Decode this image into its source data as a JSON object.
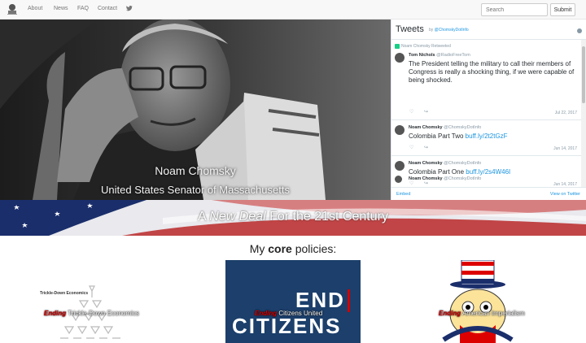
{
  "nav": {
    "links": [
      "About",
      "News",
      "FAQ",
      "Contact"
    ],
    "search_placeholder": "Search",
    "submit_label": "Submit"
  },
  "hero": {
    "name": "Noam Chomsky",
    "title": "United States Senator of Massachusetts"
  },
  "twitter": {
    "header": "Tweets",
    "by_prefix": "by",
    "by_handle": "@ChomskyDotInfo",
    "retweet_label": "Noam Chomsky Retweeted",
    "tweets": [
      {
        "author": "Tom Nichols",
        "handle": "@RadioFreeTom",
        "text": "The President telling the military to call their members of Congress is really a shocking thing, if we were capable of being shocked.",
        "link": "",
        "date": "Jul 22, 2017"
      },
      {
        "author": "Noam Chomsky",
        "handle": "@ChomskyDotInfo",
        "text": "Colombia Part Two",
        "link": "buff.ly/2t2tGzF",
        "date": "Jun 14, 2017"
      },
      {
        "author": "Noam Chomsky",
        "handle": "@ChomskyDotInfo",
        "text": "Colombia Part One",
        "link": "buff.ly/2s4W46I",
        "date": "Jun 14, 2017"
      },
      {
        "author": "Noam Chomsky",
        "handle": "@ChomskyDotInfo",
        "text": "",
        "link": "",
        "date": ""
      }
    ],
    "embed_label": "Embed",
    "view_label": "View on Twitter"
  },
  "banner": {
    "pre": "A",
    "em": "New Deal",
    "post": "For the 21st Century"
  },
  "policies": {
    "heading_pre": "My",
    "heading_bold": "core",
    "heading_post": "policies:",
    "items": [
      {
        "ending": "Ending",
        "rest": "Trickle-Down Economics",
        "image_label": "Trickle-Down Economics"
      },
      {
        "ending": "Ending",
        "rest": "Citizens United",
        "poster_line1": "END",
        "poster_line2": "CITIZENS"
      },
      {
        "ending": "Ending",
        "rest": "American Imperialism"
      }
    ]
  },
  "colors": {
    "twitter_blue": "#1b95e0",
    "navy": "#1c3f6b",
    "accent_red": "#d00000"
  }
}
